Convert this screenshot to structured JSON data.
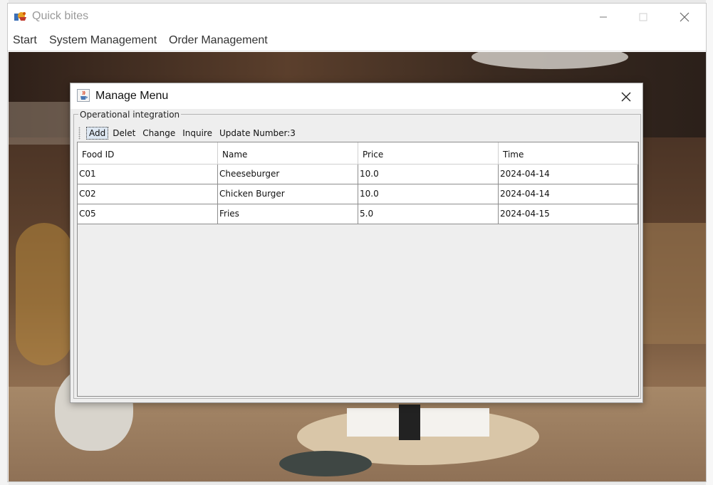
{
  "app": {
    "title": "Quick bites",
    "icon": "app-logo-icon"
  },
  "menubar": {
    "items": [
      "Start",
      "System Management",
      "Order Management"
    ]
  },
  "dialog": {
    "title": "Manage Menu",
    "icon": "java-cup-icon",
    "group_title": "Operational integration",
    "toolbar": {
      "buttons": [
        "Add",
        "Delet",
        "Change",
        "Inquire"
      ],
      "update_label": "Update Number:3"
    },
    "table": {
      "columns": [
        "Food ID",
        "Name",
        "Price",
        "Time"
      ],
      "rows": [
        [
          "C01",
          "Cheeseburger",
          "10.0",
          "2024-04-14"
        ],
        [
          "C02",
          "Chicken Burger",
          "10.0",
          "2024-04-14"
        ],
        [
          "C05",
          "Fries",
          "5.0",
          "2024-04-15"
        ]
      ]
    }
  },
  "colors": {
    "window_bg": "#ffffff",
    "dialog_bg": "#eeeeee",
    "title_gray": "#9a9a9a"
  }
}
